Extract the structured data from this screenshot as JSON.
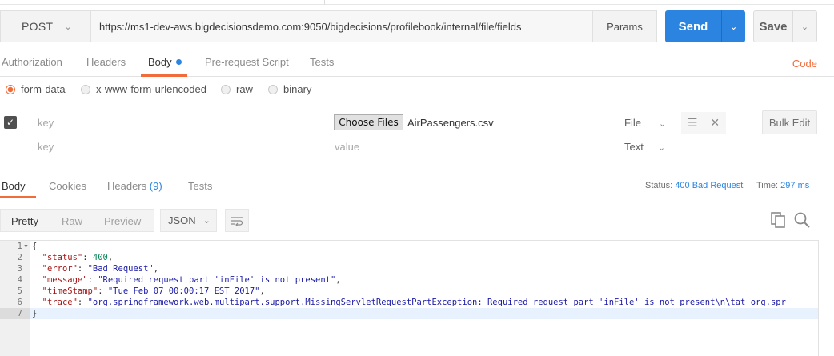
{
  "request": {
    "method": "POST",
    "url": "https://ms1-dev-aws.bigdecisionsdemo.com:9050/bigdecisions/profilebook/internal/file/fields",
    "params_label": "Params",
    "send_label": "Send",
    "save_label": "Save"
  },
  "request_tabs": [
    {
      "label": "Authorization"
    },
    {
      "label": "Headers"
    },
    {
      "label": "Body"
    },
    {
      "label": "Pre-request Script"
    },
    {
      "label": "Tests"
    }
  ],
  "code_label": "Code",
  "body_types": [
    {
      "label": "form-data",
      "selected": true
    },
    {
      "label": "x-www-form-urlencoded",
      "selected": false
    },
    {
      "label": "raw",
      "selected": false
    },
    {
      "label": "binary",
      "selected": false
    }
  ],
  "form_rows": [
    {
      "key_placeholder": "key",
      "file_button": "Choose Files",
      "file_name": "AirPassengers.csv",
      "type": "File"
    },
    {
      "key_placeholder": "key",
      "value_placeholder": "value",
      "type": "Text"
    }
  ],
  "bulk_edit_label": "Bulk Edit",
  "response_tabs": [
    {
      "label": "Body"
    },
    {
      "label": "Cookies"
    },
    {
      "label": "Headers",
      "count": "(9)"
    },
    {
      "label": "Tests"
    }
  ],
  "response_status": {
    "status_label": "Status:",
    "status_value": "400 Bad Request",
    "time_label": "Time:",
    "time_value": "297 ms"
  },
  "view_modes": [
    {
      "label": "Pretty"
    },
    {
      "label": "Raw"
    },
    {
      "label": "Preview"
    }
  ],
  "format": "JSON",
  "code_lines": [
    {
      "n": "1",
      "text": "{"
    },
    {
      "n": "2",
      "key": "\"status\"",
      "val": "400",
      "kind": "n"
    },
    {
      "n": "3",
      "key": "\"error\"",
      "val": "\"Bad Request\"",
      "kind": "s"
    },
    {
      "n": "4",
      "key": "\"message\"",
      "val": "\"Required request part 'inFile' is not present\"",
      "kind": "s"
    },
    {
      "n": "5",
      "key": "\"timeStamp\"",
      "val": "\"Tue Feb 07 00:00:17 EST 2017\"",
      "kind": "s"
    },
    {
      "n": "6",
      "key": "\"trace\"",
      "val": "\"org.springframework.web.multipart.support.MissingServletRequestPartException: Required request part 'inFile' is not present\\n\\tat org.spr",
      "kind": "s"
    },
    {
      "n": "7",
      "text": "}"
    }
  ]
}
